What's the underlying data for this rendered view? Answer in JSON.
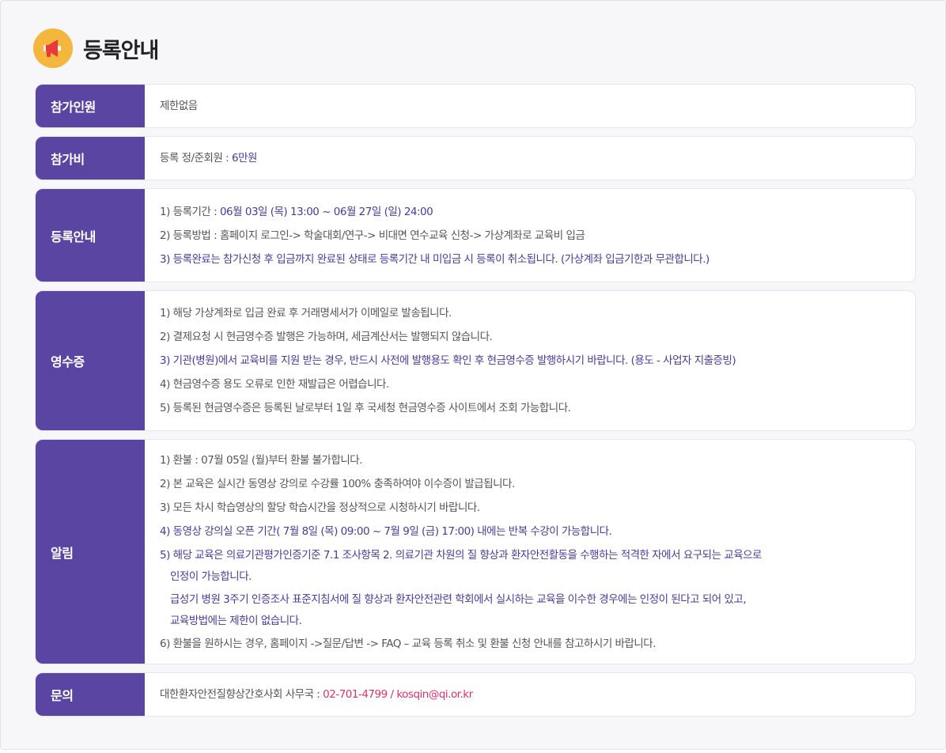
{
  "title": "등록안내",
  "megaphone_icon": "megaphone-icon",
  "colors": {
    "label_bg": "#5a45a3",
    "highlight": "#4a3a9c",
    "contact": "#e0306c",
    "icon_bg": "#f4b63c"
  },
  "participants": {
    "label": "참가인원",
    "text": "제한없음"
  },
  "fee": {
    "label": "참가비",
    "prefix": "등록 정/준회원 : ",
    "amount": "6만원"
  },
  "registration": {
    "label": "등록안내",
    "line1_prefix": "1) 등록기간 : ",
    "line1_period": "06월 03일 (목) 13:00 ~ 06월 27일 (일) 24:00",
    "line2": "2) 등록방법 : 홈페이지 로그인-> 학술대회/연구-> 비대면 연수교육 신청-> 가상계좌로 교육비 입금",
    "line3": "3) 등록완료는 참가신청 후 입금까지 완료된 상태로 등록기간 내 미입금 시 등록이 취소됩니다. (가상계좌 입금기한과 무관합니다.)"
  },
  "receipt": {
    "label": "영수증",
    "items": [
      "1) 해당 가상계좌로 입금 완료 후 거래명세서가 이메일로 발송됩니다.",
      "2) 결제요청 시 현금영수증 발행은 가능하며, 세금계산서는 발행되지 않습니다.",
      "3) 기관(병원)에서 교육비를 지원 받는 경우, 반드시 사전에 발행용도 확인 후 현금영수증 발행하시기 바랍니다. (용도 - 사업자 지출증빙)",
      "4) 현금영수증 용도 오류로 인한 재발급은 어렵습니다.",
      "5) 등록된 현금영수증은 등록된 날로부터 1일 후 국세청 현금영수증 사이트에서 조회 가능합니다."
    ]
  },
  "notice": {
    "label": "알림",
    "item1": "1) 환불 : 07월 05일 (월)부터 환불 불가합니다.",
    "item2": "2) 본 교육은 실시간 동영상 강의로 수강률 100% 충족하여야 이수증이 발급됩니다.",
    "item3": "3) 모든 차시 학습영상의 할당 학습시간을 정상적으로 시청하시기 바랍니다.",
    "item4": "4) 동영상 강의실 오픈 기간( 7월 8일 (목) 09:00 ~ 7월 9일 (금) 17:00) 내에는 반복 수강이 가능합니다.",
    "item5a": "5) 해당 교육은 의료기관평가인증기준 7.1 조사항목 2. 의료기관 차원의 질 향상과 환자안전활동을 수행하는 적격한 자에서 요구되는 교육으로",
    "item5b": "인정이 가능합니다.",
    "item5c": "급성기 병원 3주기 인증조사 표준지침서에 질 향상과 환자안전관련 학회에서 실시하는 교육을 이수한 경우에는 인정이 된다고 되어 있고,",
    "item5d": "교육방법에는 제한이 없습니다.",
    "item6": "6) 환불을 원하시는 경우, 홈페이지 ->질문/답변 -> FAQ – 교육 등록 취소 및 환불 신청 안내를 참고하시기 바랍니다."
  },
  "inquiry": {
    "label": "문의",
    "prefix": "대한환자안전질향상간호사회 사무국 : ",
    "contact": "02-701-4799 / kosqin@qi.or.kr"
  }
}
